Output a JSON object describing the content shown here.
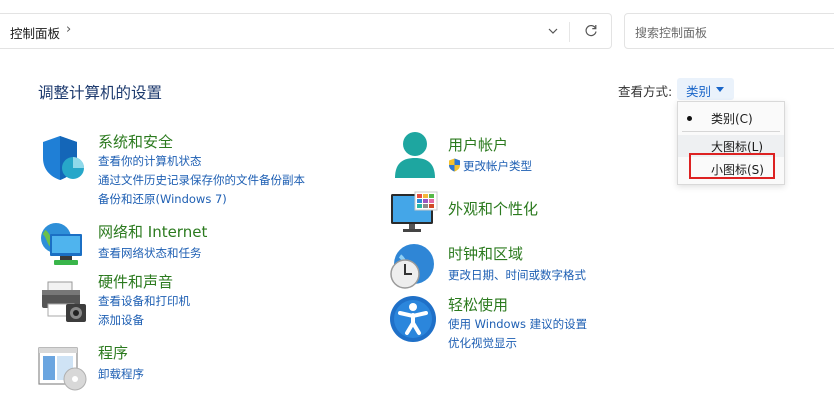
{
  "address_bar": {
    "breadcrumb": "控制面板",
    "separator": "›"
  },
  "search": {
    "placeholder": "搜索控制面板"
  },
  "header": {
    "title": "调整计算机的设置",
    "view_label": "查看方式:",
    "view_value": "类别"
  },
  "view_menu": {
    "items": [
      {
        "label": "类别(C)",
        "selected": true
      },
      {
        "label": "大图标(L)",
        "selected": false
      },
      {
        "label": "小图标(S)",
        "selected": false
      }
    ]
  },
  "categories": {
    "system": {
      "title": "系统和安全",
      "links": [
        "查看你的计算机状态",
        "通过文件历史记录保存你的文件备份副本",
        "备份和还原(Windows 7)"
      ]
    },
    "network": {
      "title": "网络和 Internet",
      "links": [
        "查看网络状态和任务"
      ]
    },
    "hardware": {
      "title": "硬件和声音",
      "links": [
        "查看设备和打印机",
        "添加设备"
      ]
    },
    "programs": {
      "title": "程序",
      "links": [
        "卸载程序"
      ]
    },
    "accounts": {
      "title": "用户帐户",
      "links": [
        "更改帐户类型"
      ]
    },
    "appearance": {
      "title": "外观和个性化",
      "links": []
    },
    "clock": {
      "title": "时钟和区域",
      "links": [
        "更改日期、时间或数字格式"
      ]
    },
    "ease": {
      "title": "轻松使用",
      "links": [
        "使用 Windows 建议的设置",
        "优化视觉显示"
      ]
    }
  },
  "colors": {
    "title_green": "#2b7a1e",
    "link_blue": "#1e5fb3",
    "highlight_red": "#dd2222"
  }
}
